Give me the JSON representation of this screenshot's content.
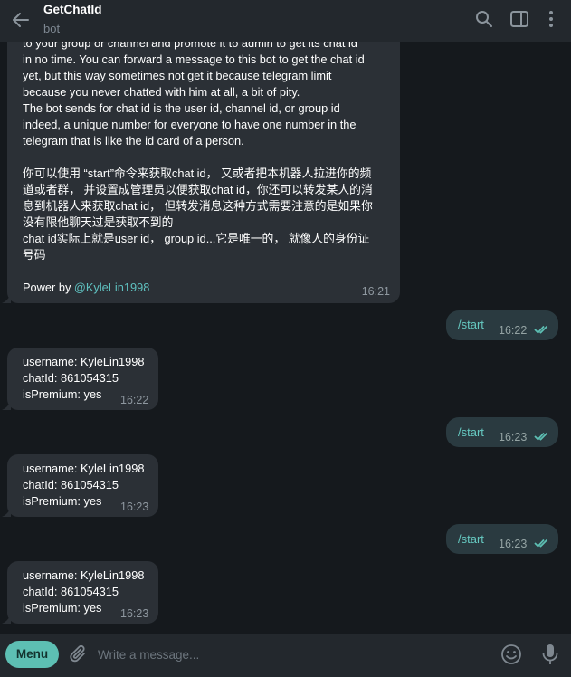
{
  "header": {
    "title": "GetChatId",
    "subtitle": "bot",
    "icons": [
      "back-arrow-icon",
      "search-icon",
      "sidebar-toggle-icon",
      "more-vertical-icon"
    ]
  },
  "messages": {
    "intro": {
      "lines": [
        "to your group or channel and promote it to admin to get its chat id",
        "in no time. You can forward a message to this bot to get the chat id",
        "yet, but this way sometimes not get it because telegram limit",
        "because you never chatted with him at all, a bit of pity.",
        "The bot sends for chat id is the user id, channel id, or group id",
        "indeed, a unique number for everyone to have one number in the",
        "telegram that is like the id card of a person.",
        "你可以使用 “start”命令来获取chat id， 又或者把本机器人拉进你的频",
        "道或者群， 并设置成管理员以便获取chat id，你还可以转发某人的消",
        "息到机器人来获取chat id， 但转发消息这种方式需要注意的是如果你",
        "没有限他聊天过是获取不到的",
        "chat id实际上就是user id， group id...它是唯一的， 就像人的身份证",
        "号码"
      ],
      "power_prefix": "Power by ",
      "power_link": "@KyleLin1998",
      "time": "16:21"
    },
    "sent": [
      {
        "text": "/start",
        "time": "16:22"
      },
      {
        "text": "/start",
        "time": "16:23"
      },
      {
        "text": "/start",
        "time": "16:23"
      }
    ],
    "replies": [
      {
        "lines": [
          "username: KyleLin1998",
          "chatId: 861054315",
          "isPremium: yes"
        ],
        "time": "16:22"
      },
      {
        "lines": [
          "username: KyleLin1998",
          "chatId: 861054315",
          "isPremium: yes"
        ],
        "time": "16:23"
      },
      {
        "lines": [
          "username: KyleLin1998",
          "chatId: 861054315",
          "isPremium: yes"
        ],
        "time": "16:23"
      }
    ]
  },
  "composer": {
    "menu_label": "Menu",
    "placeholder": "Write a message...",
    "icons": [
      "paperclip-icon",
      "emoji-icon",
      "microphone-icon"
    ]
  },
  "colors": {
    "background": "#15191d",
    "header": "#23282d",
    "incoming_bubble": "#2b3036",
    "outgoing_bubble": "#2a3a40",
    "accent": "#5dbfb3",
    "link": "#5fc1c0",
    "read_ticks": "#5dbfb3"
  }
}
